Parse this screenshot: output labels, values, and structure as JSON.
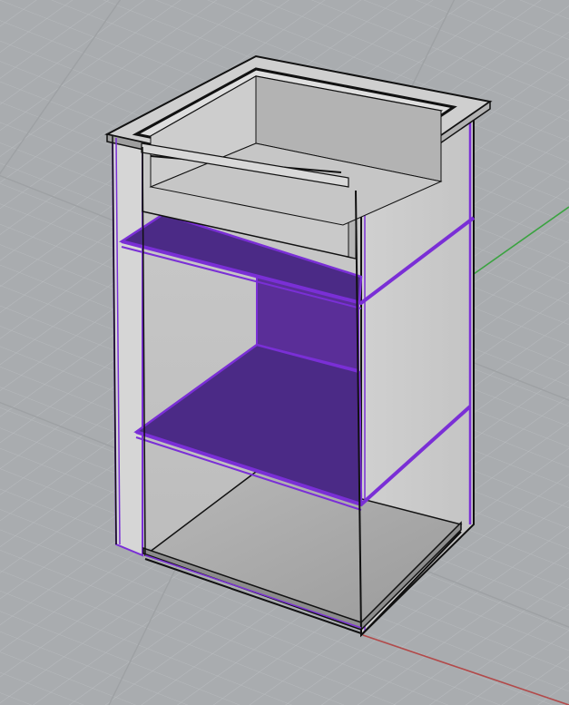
{
  "viewport": {
    "view": "perspective",
    "background": "#a9acaf",
    "grid_minor_color": "#b7babd",
    "grid_major_color": "#9ea1a4",
    "axis_x_color": "#b24a4a",
    "axis_y_color": "#3aa340"
  },
  "model": {
    "object": "sink-base-cabinet",
    "selection_color": "#7a2fd6",
    "selected_fill": "#4b2a86",
    "panel_fill": "#c7c7c7",
    "shade_fill": "#a7a7a7",
    "edge_color": "#111111",
    "selected_parts": [
      "middle-shelf",
      "lower-shelf",
      "back-panel",
      "side-panels"
    ]
  }
}
